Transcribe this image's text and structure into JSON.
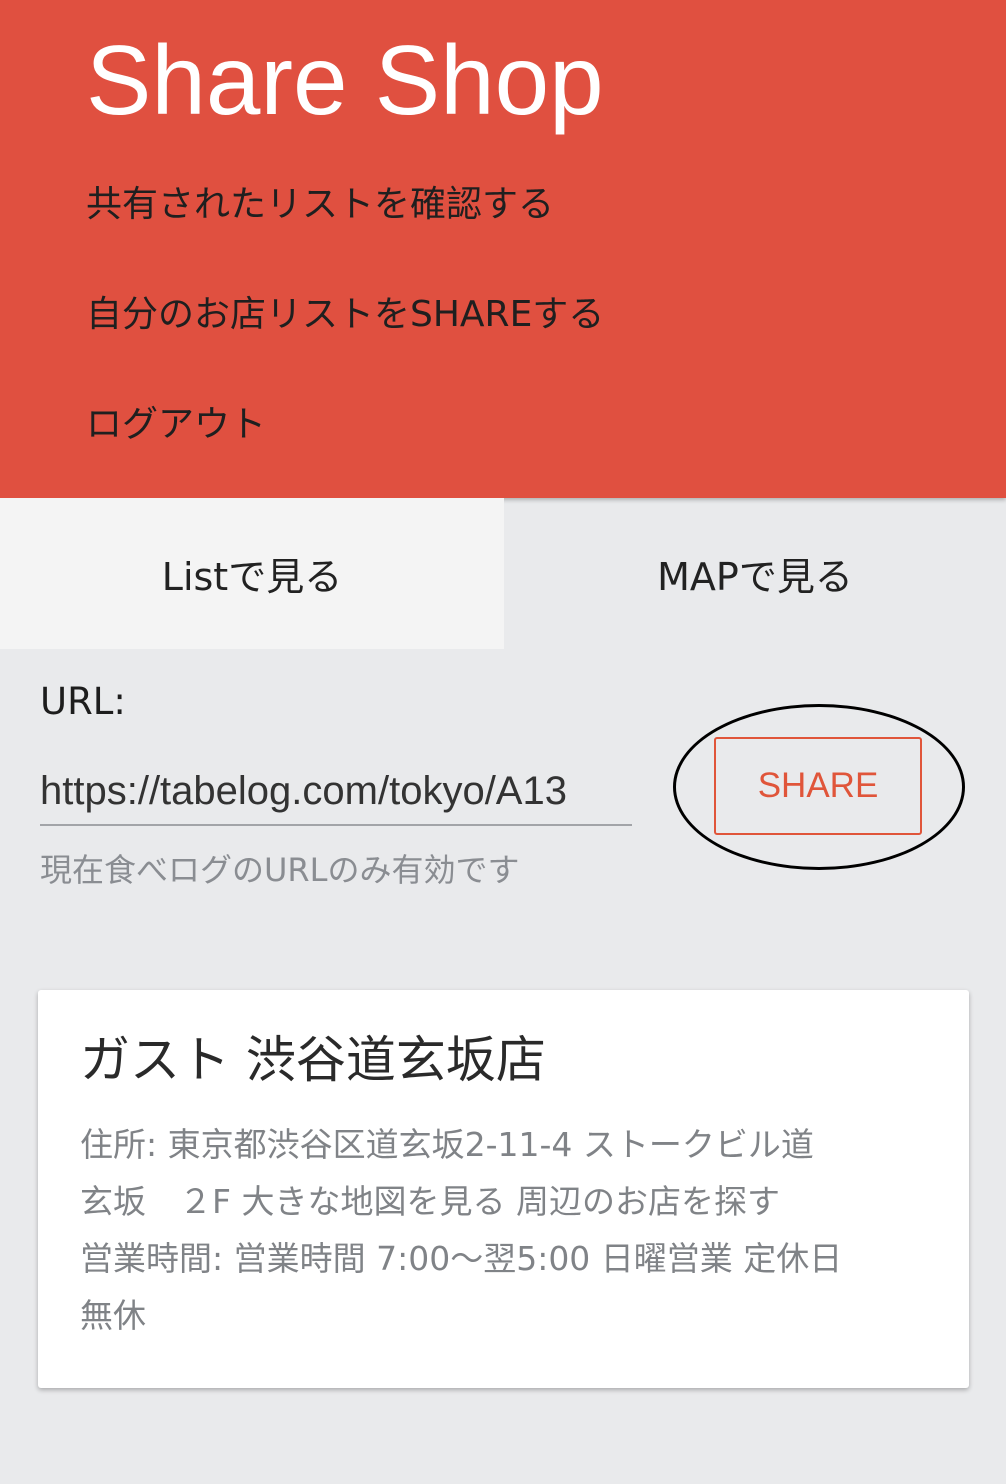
{
  "header": {
    "title": "Share Shop",
    "nav": [
      {
        "label": "共有されたリストを確認する"
      },
      {
        "label": "自分のお店リストをSHAREする"
      },
      {
        "label": "ログアウト"
      }
    ],
    "background_color": "#e05040"
  },
  "tabs": [
    {
      "label": "Listで見る",
      "selected": true
    },
    {
      "label": "MAPで見る",
      "selected": false
    }
  ],
  "url_form": {
    "label": "URL:",
    "value": "https://tabelog.com/tokyo/A13",
    "hint": "現在食べログのURLのみ有効です",
    "share_label": "SHARE",
    "accent_color": "#e0553a"
  },
  "shop_card": {
    "name": "ガスト 渋谷道玄坂店",
    "detail_lines": [
      "住所: 東京都渋谷区道玄坂2-11-4 ストークビル道",
      "玄坂　２F 大きな地図を見る 周辺のお店を探す",
      "営業時間: 営業時間 7:00～翌5:00 日曜営業 定休日",
      "無休"
    ]
  }
}
